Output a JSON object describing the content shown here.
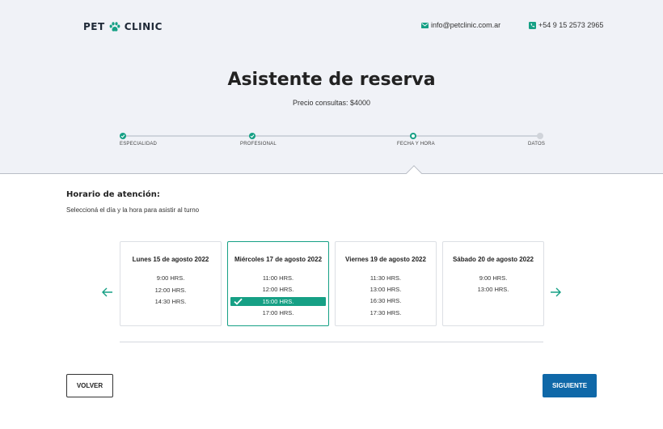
{
  "brand": {
    "left": "PET",
    "right": "CLINIC"
  },
  "contact": {
    "email": "info@petclinic.com.ar",
    "phone": "+54 9 15 2573 2965"
  },
  "header": {
    "title": "Asistente de reserva",
    "subtitle": "Precio consultas: $4000"
  },
  "steps": [
    {
      "label": "ESPECIALIDAD",
      "state": "done"
    },
    {
      "label": "PROFESIONAL",
      "state": "done"
    },
    {
      "label": "FECHA Y HORA",
      "state": "current"
    },
    {
      "label": "DATOS",
      "state": "pending"
    }
  ],
  "schedule": {
    "title": "Horario de atención:",
    "subtitle": "Seleccioná el día y la hora para asistir al turno",
    "days": [
      {
        "title": "Lunes 15 de agosto 2022",
        "slots": [
          "9:00 HRS.",
          "12:00 HRS.",
          "14:30 HRS."
        ],
        "selected_slot": null
      },
      {
        "title": "Miércoles 17 de agosto 2022",
        "slots": [
          "11:00 HRS.",
          "12:00 HRS.",
          "15:00 HRS.",
          "17:00 HRS."
        ],
        "selected_slot": 2
      },
      {
        "title": "Viernes 19 de agosto 2022",
        "slots": [
          "11:30 HRS.",
          "13:00 HRS.",
          "16:30 HRS.",
          "17:30 HRS."
        ],
        "selected_slot": null
      },
      {
        "title": "Sábado 20 de agosto 2022",
        "slots": [
          "9:00 HRS.",
          "13:00 HRS."
        ],
        "selected_slot": null
      }
    ]
  },
  "actions": {
    "back": "VOLVER",
    "next": "SIGUIENTE"
  },
  "icons": {
    "paw": "paw-icon",
    "email": "envelope-icon",
    "phone": "phone-icon",
    "prev": "arrow-left-icon",
    "next": "arrow-right-icon",
    "check": "check-icon"
  },
  "colors": {
    "accent": "#16a085",
    "primary_button": "#0f68a8",
    "hero_bg": "#f0f2f7",
    "pending_step": "#d0d4da"
  }
}
